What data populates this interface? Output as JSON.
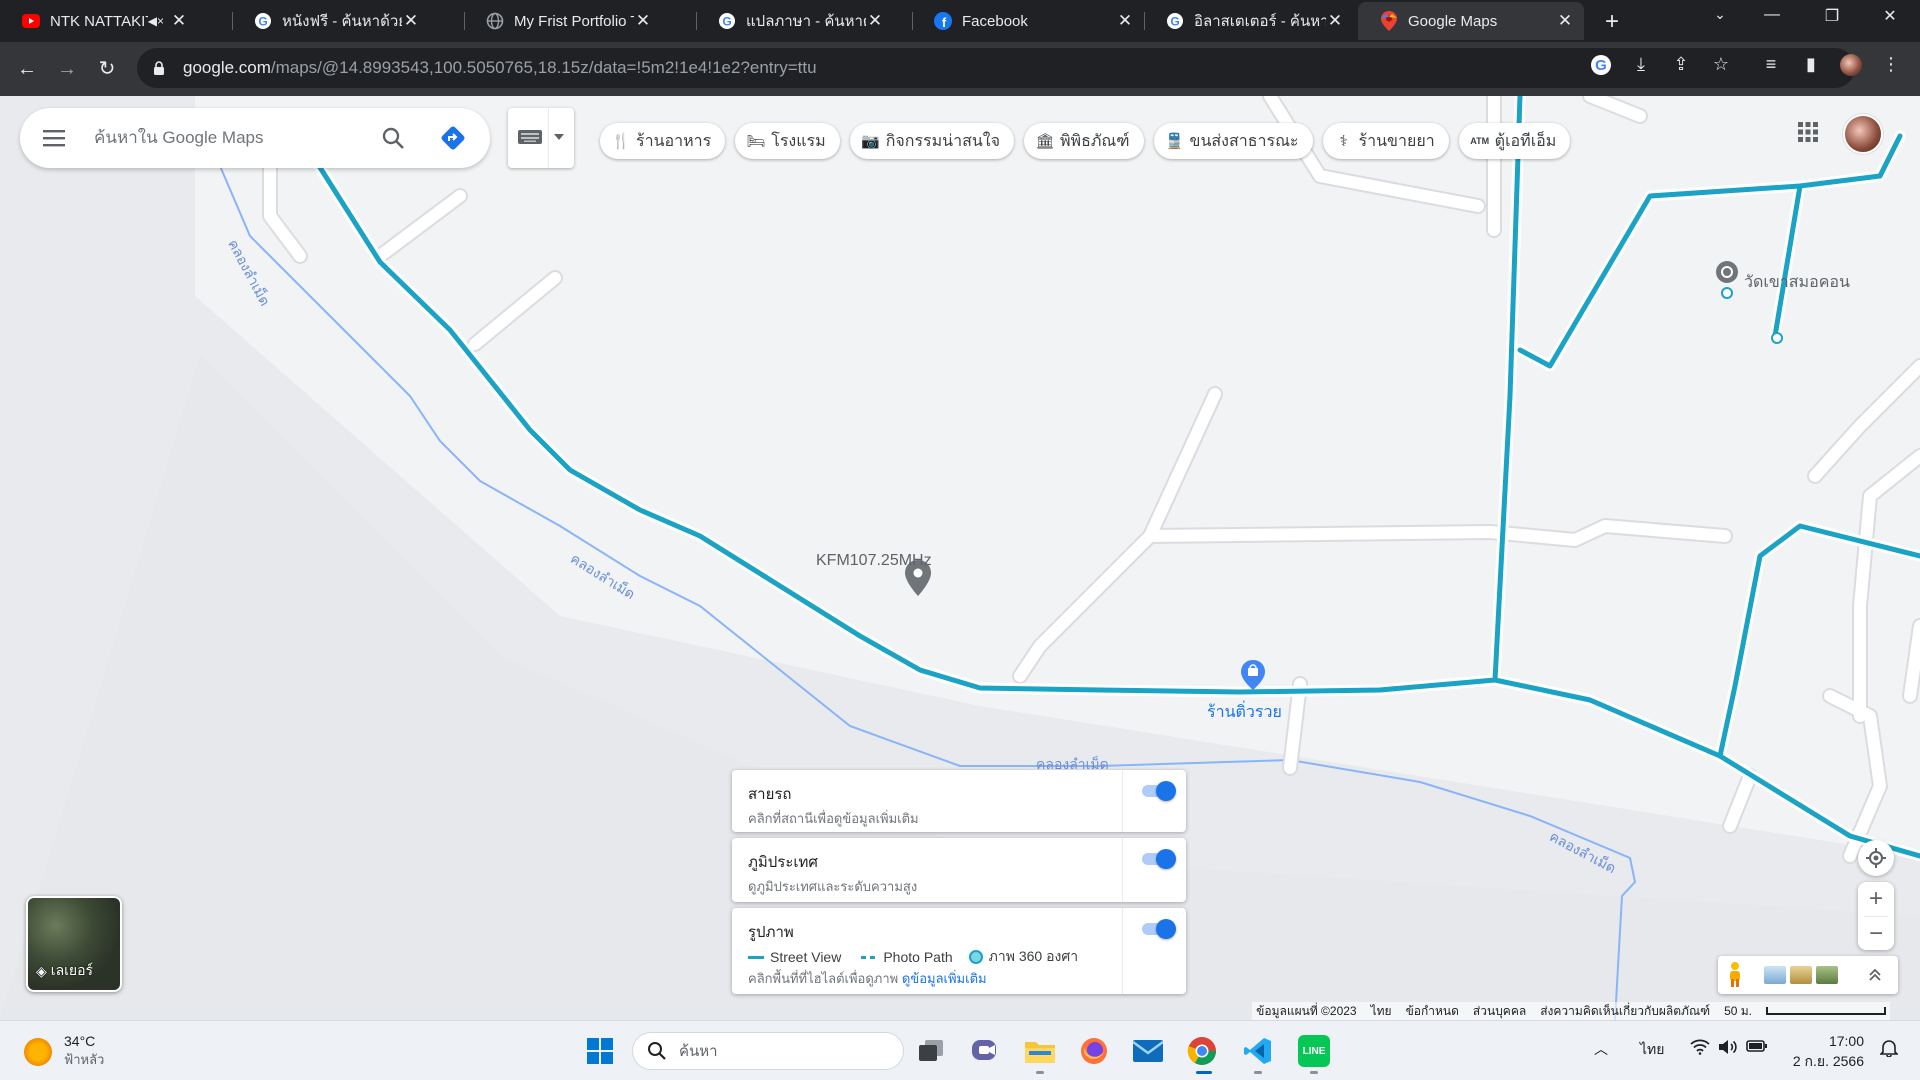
{
  "tabs": [
    {
      "title": "NTK NATTAKIT - Y",
      "icon": "youtube-icon"
    },
    {
      "title": "หนังฟรี - ค้นหาด้วย Goo",
      "icon": "google-icon"
    },
    {
      "title": "My Frist Portfolio Tem",
      "icon": "globe-icon"
    },
    {
      "title": "แปลภาษา - ค้นหาด้วย Go",
      "icon": "google-icon"
    },
    {
      "title": "Facebook",
      "icon": "facebook-icon"
    },
    {
      "title": "อิลาสเตเตอร์ - ค้นหาด้วย",
      "icon": "google-icon"
    },
    {
      "title": "Google Maps",
      "icon": "google-maps-icon"
    }
  ],
  "address": {
    "host": "google.com",
    "path": "/maps/@14.8993543,100.5050765,18.15z/data=!5m2!1e4!1e2?entry=ttu"
  },
  "search": {
    "placeholder": "ค้นหาใน Google Maps"
  },
  "chips": [
    {
      "label": "ร้านอาหาร",
      "icon": "restaurant-icon"
    },
    {
      "label": "โรงแรม",
      "icon": "hotel-icon"
    },
    {
      "label": "กิจกรรมน่าสนใจ",
      "icon": "camera-icon"
    },
    {
      "label": "พิพิธภัณฑ์",
      "icon": "museum-icon"
    },
    {
      "label": "ขนส่งสาธารณะ",
      "icon": "transit-icon"
    },
    {
      "label": "ร้านขายยา",
      "icon": "pharmacy-icon"
    },
    {
      "label": "ตู้เอทีเอ็ม",
      "icon": "atm-icon"
    }
  ],
  "map": {
    "places": {
      "radio": "KFM107.25MHz",
      "shop": "ร้านติ่วรวย",
      "temple": "วัดเขาสมอคอน"
    },
    "canal": "คลองลำเม็ด",
    "colors": {
      "street_view": "#1aa3c4",
      "canal": "#8ab4f8",
      "road": "#ffffff"
    }
  },
  "layer_panel": {
    "transit": {
      "title": "สายรถ",
      "desc": "คลิกที่สถานีเพื่อดูข้อมูลเพิ่มเติม",
      "on": true
    },
    "terrain": {
      "title": "ภูมิประเทศ",
      "desc": "ดูภูมิประเทศและระดับความสูง",
      "on": true
    },
    "photos": {
      "title": "รูปภาพ",
      "legend_street_view": "Street View",
      "legend_photo_path": "Photo Path",
      "legend_360": "ภาพ 360 องศา",
      "desc_prefix": "คลิกพื้นที่ที่ไฮไลต์เพื่อดูภาพ",
      "desc_link": "ดูข้อมูลเพิ่มเติม",
      "on": true
    }
  },
  "layers_button": {
    "label": "เลเยอร์"
  },
  "attribution": {
    "map_data": "ข้อมูลแผนที่ ©2023",
    "language": "ไทย",
    "terms": "ข้อกำหนด",
    "privacy": "ส่วนบุคคล",
    "feedback": "ส่งความคิดเห็นเกี่ยวกับผลิตภัณฑ์",
    "scale": "50 ม."
  },
  "taskbar": {
    "weather_temp": "34°C",
    "weather_cond": "ฟ้าหลัว",
    "search_placeholder": "ค้นหา",
    "language": "ไทย",
    "time": "17:00",
    "date": "2 ก.ย. 2566"
  }
}
